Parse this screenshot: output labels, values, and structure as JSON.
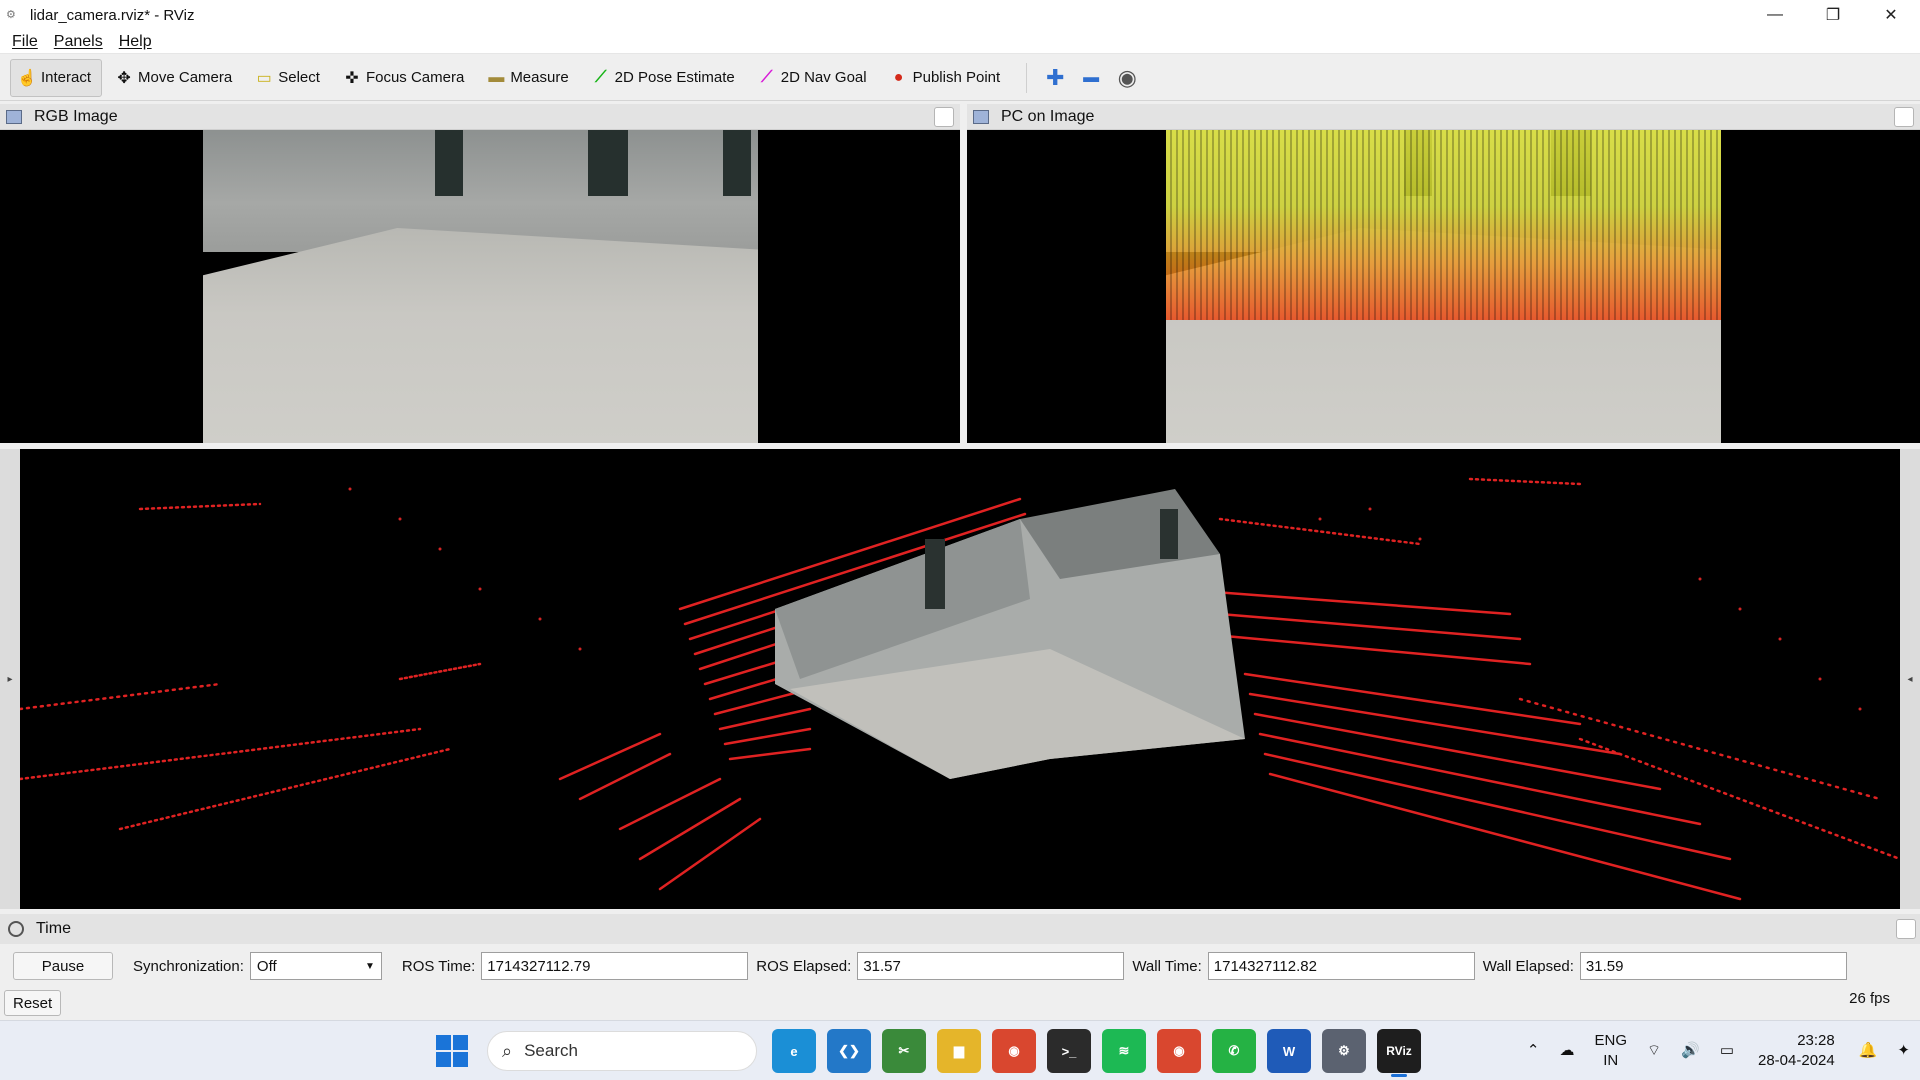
{
  "window": {
    "title": "lidar_camera.rviz* - RViz",
    "minimize_glyph": "—",
    "maximize_glyph": "❐",
    "close_glyph": "✕"
  },
  "menu": [
    "File",
    "Panels",
    "Help"
  ],
  "toolbar": {
    "tools": [
      {
        "label": "Interact",
        "icon": "hand-pointer-icon",
        "glyph": "☝",
        "color": "#333333"
      },
      {
        "label": "Move Camera",
        "icon": "move-camera-icon",
        "glyph": "✥",
        "color": "#666666"
      },
      {
        "label": "Select",
        "icon": "select-box-icon",
        "glyph": "▭",
        "color": "#c9b21d"
      },
      {
        "label": "Focus Camera",
        "icon": "focus-camera-icon",
        "glyph": "✜",
        "color": "#666666"
      },
      {
        "label": "Measure",
        "icon": "ruler-icon",
        "glyph": "▬",
        "color": "#a38b3a"
      },
      {
        "label": "2D Pose Estimate",
        "icon": "pose-arrow-icon",
        "glyph": "⟋",
        "color": "#18b418"
      },
      {
        "label": "2D Nav Goal",
        "icon": "nav-arrow-icon",
        "glyph": "⟋",
        "color": "#d81ad8"
      },
      {
        "label": "Publish Point",
        "icon": "map-pin-icon",
        "glyph": "📍",
        "color": "#d42a1a"
      }
    ],
    "extra_icons": [
      {
        "name": "add-tool-icon",
        "glyph": "✚",
        "color": "#2f6fd0"
      },
      {
        "name": "remove-tool-icon",
        "glyph": "▬",
        "color": "#2f6fd0"
      },
      {
        "name": "camera-type-icon",
        "glyph": "◉",
        "color": "#555555"
      }
    ]
  },
  "panels": {
    "rgb": {
      "title": "RGB Image"
    },
    "pc": {
      "title": "PC on Image"
    }
  },
  "time_panel": {
    "title": "Time",
    "pause_label": "Pause",
    "sync_label": "Synchronization:",
    "sync_value": "Off",
    "ros_time_label": "ROS Time:",
    "ros_time_value": "1714327112.79",
    "ros_elapsed_label": "ROS Elapsed:",
    "ros_elapsed_value": "31.57",
    "wall_time_label": "Wall Time:",
    "wall_time_value": "1714327112.82",
    "wall_elapsed_label": "Wall Elapsed:",
    "wall_elapsed_value": "31.59",
    "reset_label": "Reset",
    "fps": "26 fps"
  },
  "taskbar": {
    "search_label": "Search",
    "apps": [
      {
        "name": "edge-app",
        "label": "e",
        "color": "#1b8fd6"
      },
      {
        "name": "vscode-app",
        "label": "❮❯",
        "color": "#2378c8"
      },
      {
        "name": "snipping-app",
        "label": "✂",
        "color": "#3a8a3a"
      },
      {
        "name": "explorer-app",
        "label": "▆",
        "color": "#e5b52a"
      },
      {
        "name": "chrome-app",
        "label": "◉",
        "color": "#d9472f"
      },
      {
        "name": "terminal-app",
        "label": ">_",
        "color": "#2b2b2b"
      },
      {
        "name": "spotify-app",
        "label": "≋",
        "color": "#1db954"
      },
      {
        "name": "chrome-profile-app",
        "label": "◉",
        "color": "#d9472f"
      },
      {
        "name": "whatsapp-app",
        "label": "✆",
        "color": "#25b244"
      },
      {
        "name": "word-app",
        "label": "W",
        "color": "#1f5bb8"
      },
      {
        "name": "settings-app",
        "label": "⚙",
        "color": "#5b6270"
      },
      {
        "name": "rviz-app",
        "label": "RViz",
        "color": "#1e1e1e"
      }
    ],
    "lang_line1": "ENG",
    "lang_line2": "IN",
    "time": "23:28",
    "date": "28-04-2024"
  }
}
